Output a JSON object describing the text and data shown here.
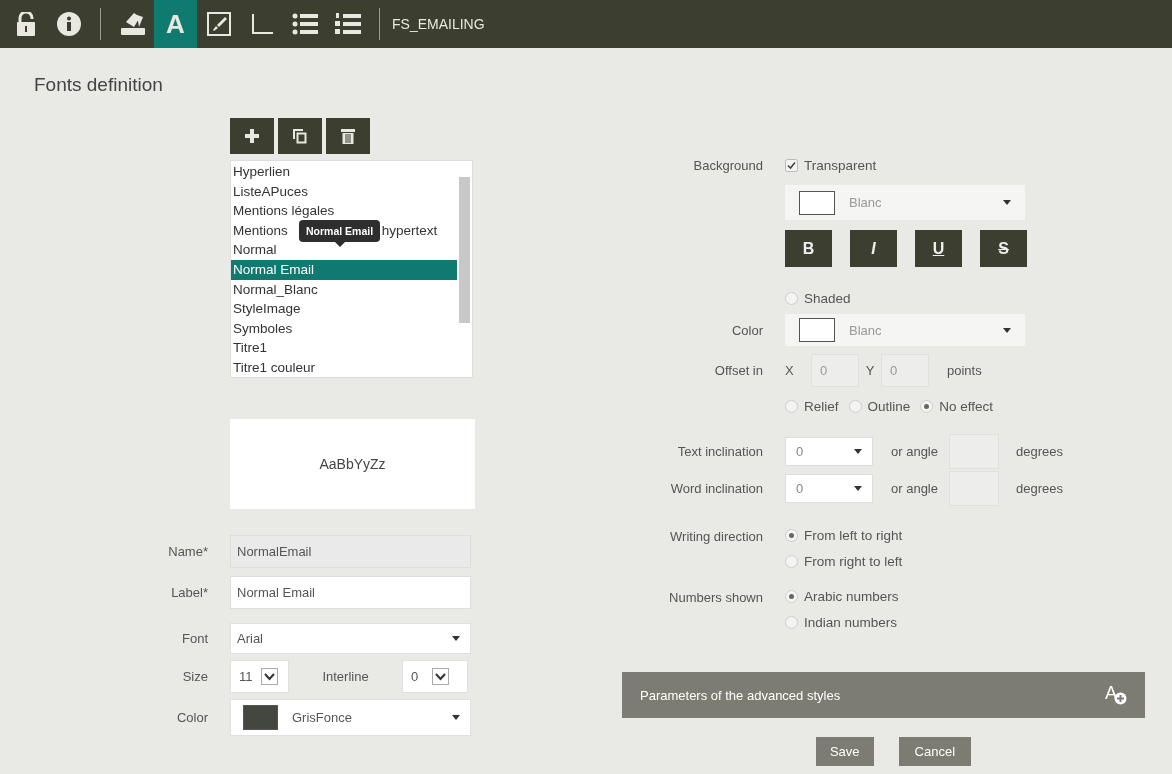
{
  "toolbar": {
    "groups": [
      [
        {
          "kind": "lock",
          "selected": false
        },
        {
          "kind": "info",
          "selected": false
        }
      ],
      [
        {
          "kind": "tray",
          "selected": false
        },
        {
          "kind": "letter",
          "label": "A",
          "selected": true
        },
        {
          "kind": "brush",
          "selected": false
        },
        {
          "kind": "corner",
          "selected": false
        },
        {
          "kind": "bullets",
          "selected": false
        },
        {
          "kind": "numbers",
          "selected": false
        }
      ]
    ],
    "title": "FS_EMAILING"
  },
  "page_title": "Fonts definition",
  "list_actions": [
    {
      "kind": "add"
    },
    {
      "kind": "copy"
    },
    {
      "kind": "delete"
    }
  ],
  "styles_list": {
    "tooltip": "Normal Email",
    "items": [
      {
        "label": "Hyperlien",
        "selected": false
      },
      {
        "label": "ListeAPuces",
        "selected": false
      },
      {
        "label": "Mentions légales",
        "selected": false
      },
      {
        "label": "Mentions",
        "label_tail": "hypertext",
        "selected": false
      },
      {
        "label": "Normal",
        "selected": false
      },
      {
        "label": "Normal Email",
        "selected": true
      },
      {
        "label": "Normal_Blanc",
        "selected": false
      },
      {
        "label": "StyleImage",
        "selected": false
      },
      {
        "label": "Symboles",
        "selected": false
      },
      {
        "label": "Titre1",
        "selected": false
      },
      {
        "label": "Titre1 couleur",
        "selected": false
      }
    ]
  },
  "preview": "AaBbYyZz",
  "form": {
    "name": {
      "label": "Name*",
      "value": "NormalEmail",
      "disabled": true
    },
    "label": {
      "label": "Label*",
      "value": "Normal Email",
      "disabled": false
    },
    "font": {
      "label": "Font",
      "value": "Arial"
    },
    "size": {
      "label": "Size",
      "value": "11"
    },
    "interline": {
      "label": "Interline",
      "value": "0"
    },
    "color": {
      "label": "Color",
      "value": "GrisFonce",
      "color": "#44473f"
    }
  },
  "background": {
    "label": "Background",
    "transparent": {
      "label": "Transparent",
      "checked": true
    },
    "color_select": {
      "value": "Blanc",
      "color": "#ffffff"
    },
    "format_buttons": [
      {
        "kind": "bold",
        "label": "B"
      },
      {
        "kind": "italic",
        "label": "I"
      },
      {
        "kind": "underline",
        "label": "U"
      },
      {
        "kind": "strike",
        "label": "S"
      }
    ]
  },
  "shaded": {
    "label": "Shaded",
    "selected": false
  },
  "shade_color": {
    "label": "Color",
    "value": "Blanc",
    "color": "#ffffff"
  },
  "offset": {
    "label": "Offset in",
    "x_label": "X",
    "x_value": "0",
    "y_label": "Y",
    "y_value": "0",
    "unit": "points"
  },
  "effects": [
    {
      "label": "Relief",
      "selected": false
    },
    {
      "label": "Outline",
      "selected": false
    },
    {
      "label": "No effect",
      "selected": true
    }
  ],
  "inclinations": [
    {
      "label": "Text inclination",
      "value": "0",
      "or_label": "or angle",
      "unit": "degrees"
    },
    {
      "label": "Word inclination",
      "value": "0",
      "or_label": "or angle",
      "unit": "degrees"
    }
  ],
  "writing_direction": {
    "label": "Writing direction",
    "options": [
      {
        "label": "From left to right",
        "selected": true
      },
      {
        "label": "From right to left",
        "selected": false
      }
    ]
  },
  "numbers_shown": {
    "label": "Numbers shown",
    "options": [
      {
        "label": "Arabic numbers",
        "selected": true
      },
      {
        "label": "Indian numbers",
        "selected": false
      }
    ]
  },
  "advanced": {
    "label": "Parameters of the advanced styles",
    "icon_letter": "A"
  },
  "buttons": [
    {
      "kind": "primary",
      "label": "Save"
    },
    {
      "kind": "secondary",
      "label": "Cancel"
    }
  ]
}
